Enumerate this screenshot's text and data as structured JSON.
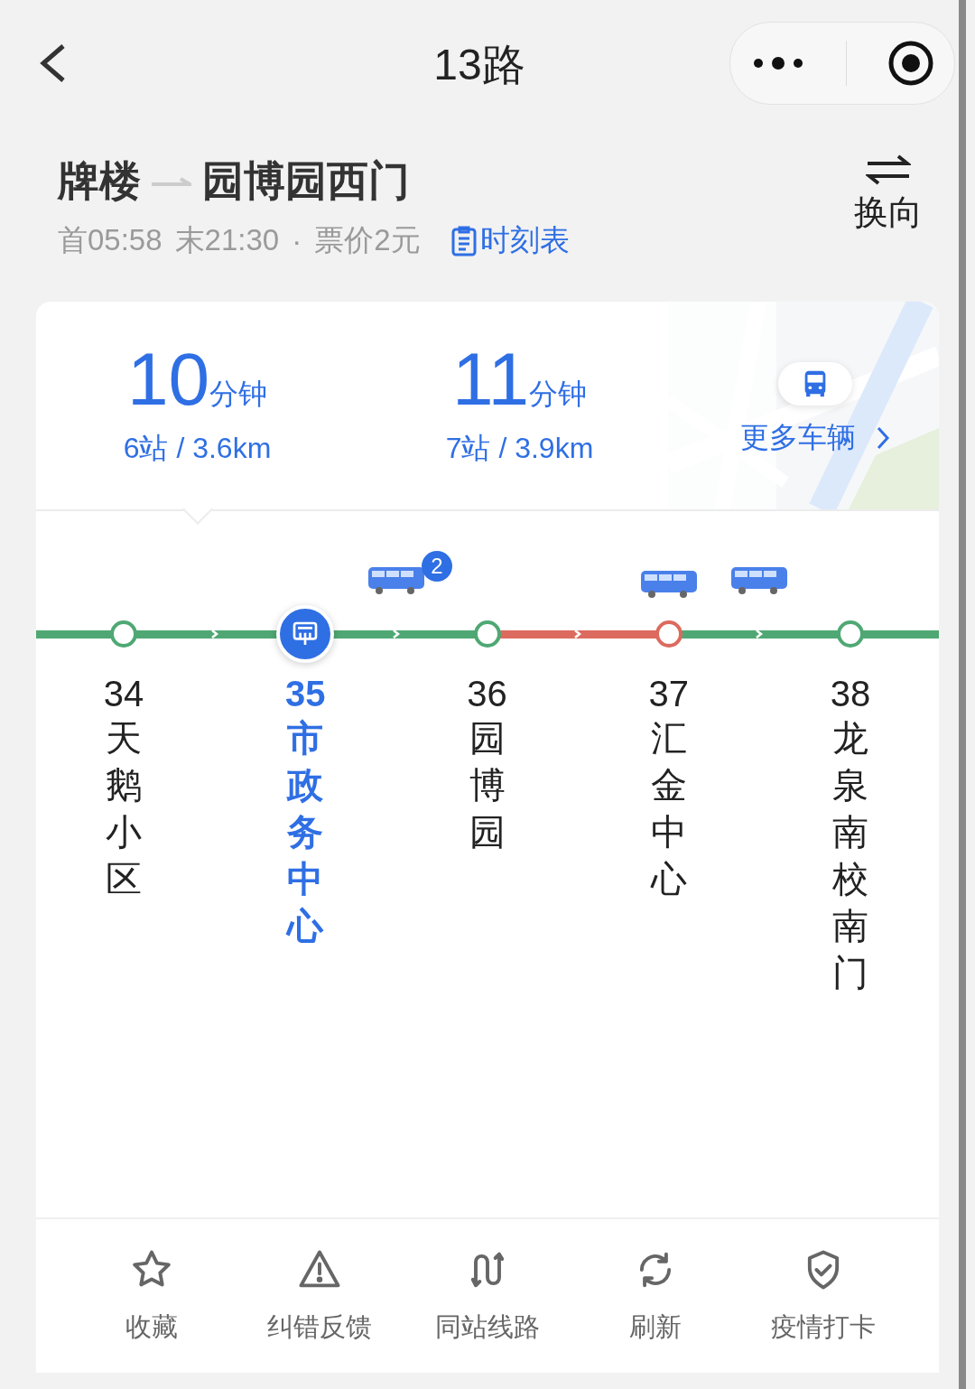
{
  "header": {
    "title": "13路"
  },
  "route": {
    "from": "牌楼",
    "to": "园博园西门",
    "first": "首05:58",
    "last": "末21:30",
    "separator": "·",
    "fare": "票价2元",
    "timetable": "时刻表",
    "reverse": "换向"
  },
  "arrivals": [
    {
      "minutes": "10",
      "unit": "分钟",
      "detail": "6站 / 3.6km",
      "selected": true
    },
    {
      "minutes": "11",
      "unit": "分钟",
      "detail": "7站 / 3.9km",
      "selected": false
    }
  ],
  "more_vehicles": "更多车辆",
  "line": {
    "segments": [
      {
        "color": "#4fa874"
      },
      {
        "color": "#4fa874"
      },
      {
        "color": "#4fa874",
        "bus": true,
        "badge": "2"
      },
      {
        "color": "#dc6a5e"
      },
      {
        "color": "#4fa874",
        "bus": true
      },
      {
        "color": "#4fa874"
      }
    ],
    "stations": [
      {
        "number": "34",
        "name": "天鹅小区",
        "kind": "stop",
        "color": "#4fa874"
      },
      {
        "number": "35",
        "name": "市政务中心",
        "kind": "current",
        "color": "#2f6fe4"
      },
      {
        "number": "36",
        "name": "园博园",
        "kind": "stop",
        "color": "#4fa874"
      },
      {
        "number": "37",
        "name": "汇金中心",
        "kind": "stop",
        "color": "#dc6a5e",
        "bus": true
      },
      {
        "number": "38",
        "name": "龙泉南校南门",
        "kind": "stop",
        "color": "#4fa874"
      }
    ]
  },
  "actions": [
    {
      "label": "收藏",
      "kind": "star"
    },
    {
      "label": "纠错反馈",
      "kind": "warning"
    },
    {
      "label": "同站线路",
      "kind": "lines"
    },
    {
      "label": "刷新",
      "kind": "refresh"
    },
    {
      "label": "疫情打卡",
      "kind": "shield"
    }
  ]
}
